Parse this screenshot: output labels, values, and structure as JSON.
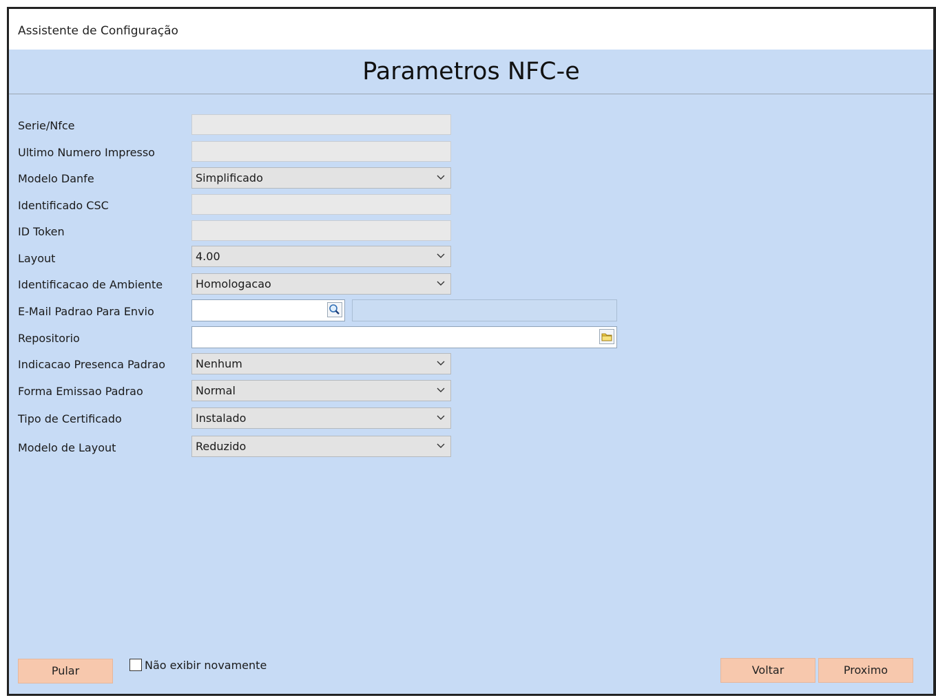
{
  "window": {
    "title": "Assistente de Configuração"
  },
  "header": {
    "title": "Parametros NFC-e"
  },
  "form": {
    "serie_label": "Serie/Nfce",
    "serie_value": "",
    "ultimo_label": "Ultimo Numero Impresso",
    "ultimo_value": "",
    "modelo_danfe_label": "Modelo Danfe",
    "modelo_danfe_value": "Simplificado",
    "csc_label": "Identificado CSC",
    "csc_value": "",
    "token_label": "ID Token",
    "token_value": "",
    "layout_label": "Layout",
    "layout_value": "4.00",
    "ambiente_label": "Identificacao de Ambiente",
    "ambiente_value": "Homologacao",
    "email_label": "E-Mail Padrao Para Envio",
    "email_value": "",
    "email_desc_value": "",
    "repositorio_label": "Repositorio",
    "repositorio_value": "",
    "presenca_label": "Indicacao Presenca Padrao",
    "presenca_value": "Nenhum",
    "emissao_label": "Forma Emissao Padrao",
    "emissao_value": "Normal",
    "certificado_label": "Tipo de Certificado",
    "certificado_value": "Instalado",
    "modelo_layout_label": "Modelo de Layout",
    "modelo_layout_value": "Reduzido"
  },
  "footer": {
    "skip_label": "Pular",
    "dont_show_label": "Não exibir novamente",
    "back_label": "Voltar",
    "next_label": "Proximo"
  },
  "icons": {
    "email_lookup": "search-icon",
    "repo_browse": "folder-icon",
    "dropdown": "chevron-down-icon"
  },
  "colors": {
    "background": "#c7dbf5",
    "button": "#f7c8ad"
  }
}
